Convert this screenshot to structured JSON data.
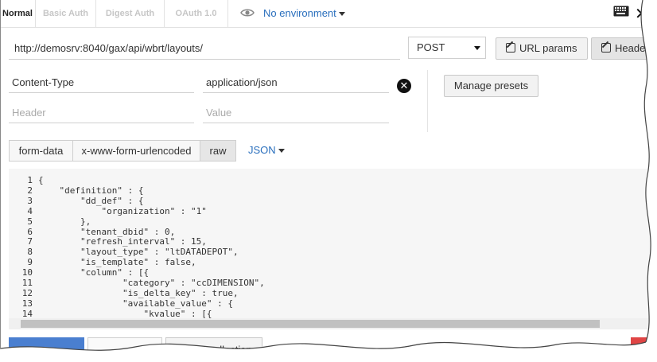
{
  "auth_tabs": [
    "Normal",
    "Basic Auth",
    "Digest Auth",
    "OAuth 1.0"
  ],
  "environment": {
    "label": "No environment"
  },
  "request": {
    "url": "http://demosrv:8040/gax/api/wbrt/layouts/",
    "method": "POST"
  },
  "toolbar": {
    "url_params": "URL params",
    "headers": "Headers"
  },
  "headers": {
    "rows": [
      {
        "key": "Content-Type",
        "value": "application/json"
      }
    ],
    "key_placeholder": "Header",
    "value_placeholder": "Value",
    "manage_presets": "Manage presets"
  },
  "body_tabs": [
    "form-data",
    "x-www-form-urlencoded",
    "raw"
  ],
  "body_format": "JSON",
  "editor": {
    "line_numbers": [
      "1",
      "2",
      "3",
      "4",
      "5",
      "6",
      "7",
      "8",
      "9",
      "10",
      "11",
      "12",
      "13",
      "14"
    ],
    "lines": [
      "{",
      "    \"definition\" : {",
      "        \"dd_def\" : {",
      "            \"organization\" : \"1\"",
      "        },",
      "        \"tenant_dbid\" : 0,",
      "        \"refresh_interval\" : 15,",
      "        \"layout_type\" : \"ltDATADEPOT\",",
      "        \"is_template\" : false,",
      "        \"column\" : [{",
      "                \"category\" : \"ccDIMENSION\",",
      "                \"is_delta_key\" : true,",
      "                \"available_value\" : {",
      "                    \"kvalue\" : [{"
    ]
  },
  "footer": {
    "add_to_collection": "Add to collection"
  },
  "colors": {
    "accent": "#2a6fbd",
    "primary": "#4a7fd0",
    "danger": "#e04545"
  }
}
